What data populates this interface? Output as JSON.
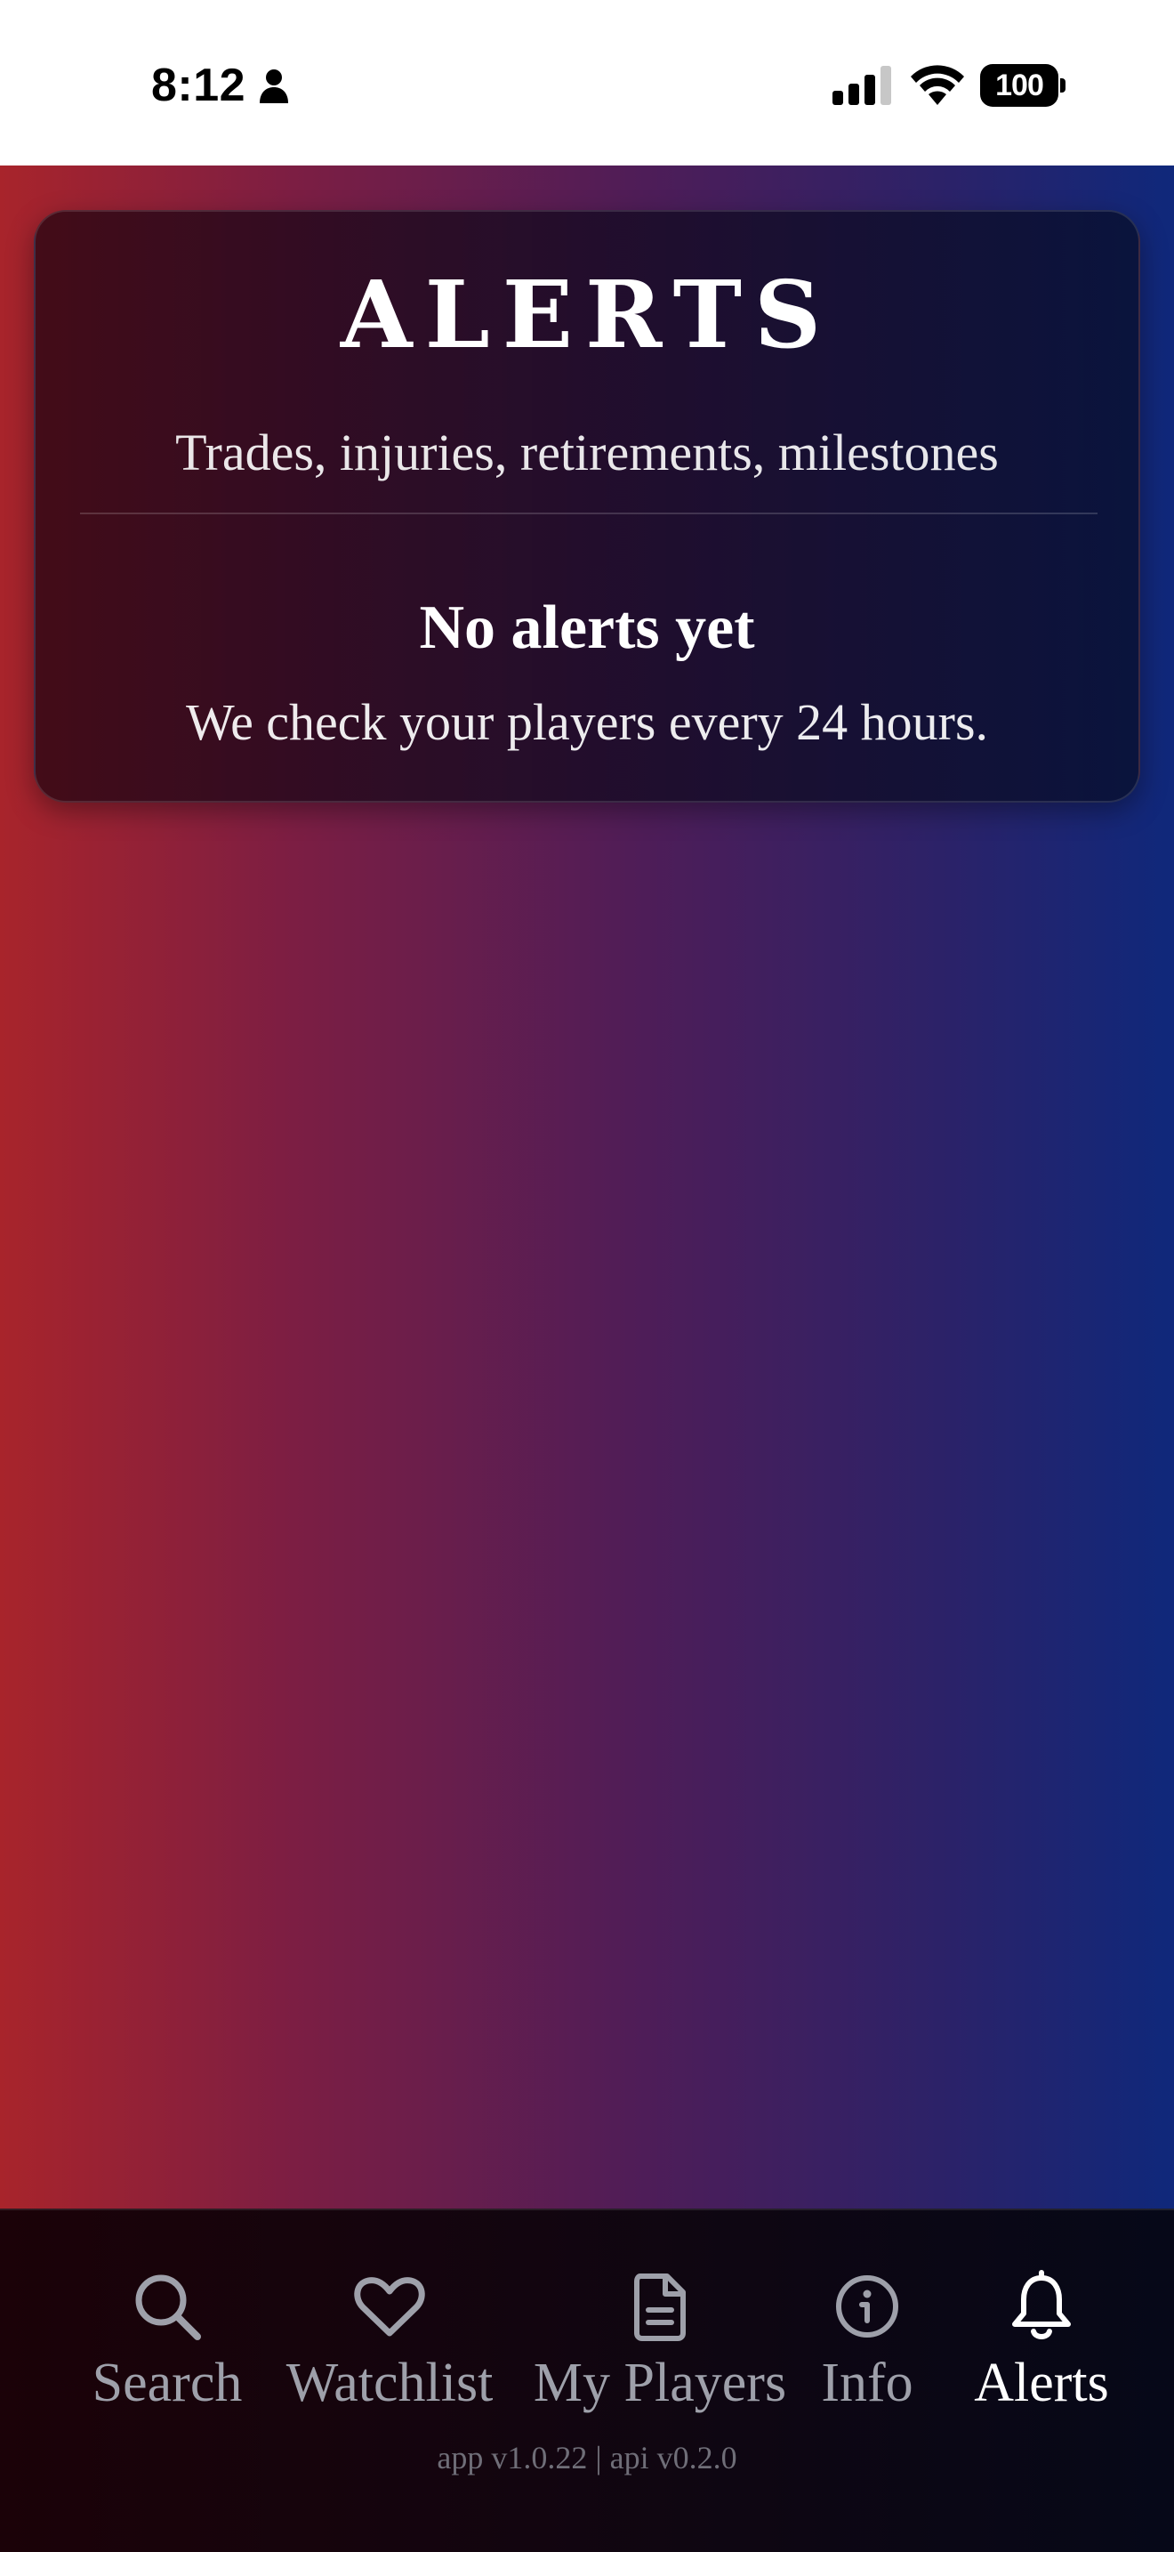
{
  "status_bar": {
    "time": "8:12",
    "battery": "100"
  },
  "card": {
    "title": "ALERTS",
    "subtitle": "Trades, injuries, retirements, milestones",
    "empty_title": "No alerts yet",
    "empty_text": "We check your players every 24 hours."
  },
  "tabs": [
    {
      "label": "Search",
      "icon": "search-icon",
      "active": false
    },
    {
      "label": "Watchlist",
      "icon": "heart-icon",
      "active": false
    },
    {
      "label": "My Players",
      "icon": "document-icon",
      "active": false
    },
    {
      "label": "Info",
      "icon": "info-icon",
      "active": false
    },
    {
      "label": "Alerts",
      "icon": "bell-icon",
      "active": true
    }
  ],
  "footer": {
    "version": "app v1.0.22 | api v0.2.0"
  },
  "colors": {
    "gradient_left": "#a8242b",
    "gradient_right": "#0f287b",
    "tab_inactive": "#9ea0aa",
    "tab_active": "#ffffff"
  }
}
